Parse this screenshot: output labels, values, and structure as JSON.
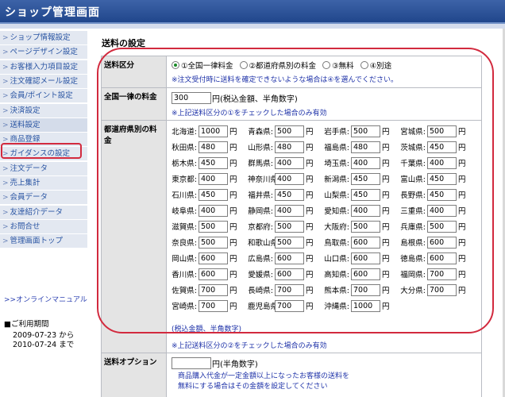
{
  "header": {
    "title": "ショップ管理画面"
  },
  "sidebar": {
    "items": [
      {
        "label": "ショップ情報設定"
      },
      {
        "label": "ページデザイン設定"
      },
      {
        "label": "お客様入力項目設定"
      },
      {
        "label": "注文確認メール設定"
      },
      {
        "label": "会員/ポイント設定"
      },
      {
        "label": "決済設定"
      },
      {
        "label": "送料設定"
      },
      {
        "label": "商品登録"
      },
      {
        "label": "ガイダンスの設定"
      },
      {
        "label": "注文データ"
      },
      {
        "label": "売上集計"
      },
      {
        "label": "会員データ"
      },
      {
        "label": "友達紹介データ"
      },
      {
        "label": "お問合せ"
      },
      {
        "label": "管理画面トップ"
      }
    ],
    "active_index": 6,
    "manual_link": ">>オンラインマニュアル",
    "period": {
      "title": "■ご利用期間",
      "from": "2009-07-23  から",
      "to": "2010-07-24  まで"
    }
  },
  "main": {
    "title": "送料の設定",
    "shipping_type": {
      "label": "送料区分",
      "options": [
        "①全国一律料金",
        "②都道府県別の料金",
        "③無料",
        "④別途"
      ],
      "selected_index": 0,
      "note": "※注文受付時に送料を確定できないような場合は④を選んでください。"
    },
    "flat_rate": {
      "label": "全国一律の料金",
      "value": "300",
      "suffix": "円(税込金額、半角数字)",
      "note": "※上記送料区分の①をチェックした場合のみ有効"
    },
    "prefecture_rates": {
      "label": "都道府県別の料金",
      "unit": "円",
      "prefectures": [
        {
          "name": "北海道:",
          "value": "1000"
        },
        {
          "name": "青森県:",
          "value": "500"
        },
        {
          "name": "岩手県:",
          "value": "500"
        },
        {
          "name": "宮城県:",
          "value": "500"
        },
        {
          "name": "秋田県:",
          "value": "480"
        },
        {
          "name": "山形県:",
          "value": "480"
        },
        {
          "name": "福島県:",
          "value": "480"
        },
        {
          "name": "茨城県:",
          "value": "450"
        },
        {
          "name": "栃木県:",
          "value": "450"
        },
        {
          "name": "群馬県:",
          "value": "400"
        },
        {
          "name": "埼玉県:",
          "value": "400"
        },
        {
          "name": "千葉県:",
          "value": "400"
        },
        {
          "name": "東京都:",
          "value": "400"
        },
        {
          "name": "神奈川県:",
          "value": "400"
        },
        {
          "name": "新潟県:",
          "value": "450"
        },
        {
          "name": "富山県:",
          "value": "450"
        },
        {
          "name": "石川県:",
          "value": "450"
        },
        {
          "name": "福井県:",
          "value": "450"
        },
        {
          "name": "山梨県:",
          "value": "450"
        },
        {
          "name": "長野県:",
          "value": "450"
        },
        {
          "name": "岐阜県:",
          "value": "400"
        },
        {
          "name": "静岡県:",
          "value": "400"
        },
        {
          "name": "愛知県:",
          "value": "400"
        },
        {
          "name": "三重県:",
          "value": "400"
        },
        {
          "name": "滋賀県:",
          "value": "500"
        },
        {
          "name": "京都府:",
          "value": "500"
        },
        {
          "name": "大阪府:",
          "value": "500"
        },
        {
          "name": "兵庫県:",
          "value": "500"
        },
        {
          "name": "奈良県:",
          "value": "500"
        },
        {
          "name": "和歌山県:",
          "value": "500"
        },
        {
          "name": "鳥取県:",
          "value": "600"
        },
        {
          "name": "島根県:",
          "value": "600"
        },
        {
          "name": "岡山県:",
          "value": "600"
        },
        {
          "name": "広島県:",
          "value": "600"
        },
        {
          "name": "山口県:",
          "value": "600"
        },
        {
          "name": "徳島県:",
          "value": "600"
        },
        {
          "name": "香川県:",
          "value": "600"
        },
        {
          "name": "愛媛県:",
          "value": "600"
        },
        {
          "name": "高知県:",
          "value": "600"
        },
        {
          "name": "福岡県:",
          "value": "700"
        },
        {
          "name": "佐賀県:",
          "value": "700"
        },
        {
          "name": "長崎県:",
          "value": "700"
        },
        {
          "name": "熊本県:",
          "value": "700"
        },
        {
          "name": "大分県:",
          "value": "700"
        },
        {
          "name": "宮崎県:",
          "value": "700"
        },
        {
          "name": "鹿児島県:",
          "value": "700"
        },
        {
          "name": "沖縄県:",
          "value": "1000"
        }
      ],
      "footnote": "(税込金額、半角数字)",
      "note": "※上記送料区分の②をチェックした場合のみ有効"
    },
    "shipping_option": {
      "label": "送料オプション",
      "value": "",
      "suffix": "円(半角数字)",
      "desc1": "商品購入代金が一定金額以上になったお客様の送料を",
      "desc2": "無料にする場合はその金額を設定してください"
    }
  },
  "colors": {
    "header": "#2a4f94",
    "highlight": "#d22a3e",
    "note": "#1e32a8",
    "label_bg": "#e4e4e4",
    "nav_bg": "#e3e8f1"
  }
}
